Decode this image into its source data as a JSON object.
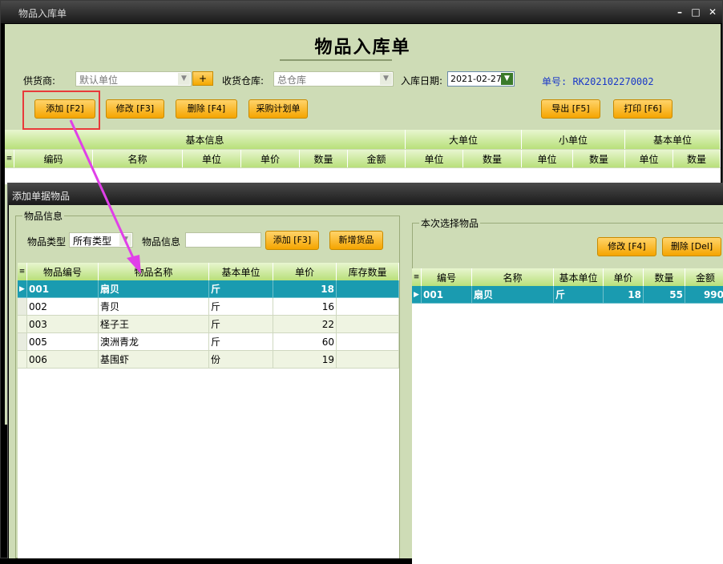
{
  "main_window": {
    "title": "物品入库单",
    "controls": {
      "minimize": "–",
      "maximize": "□",
      "close": "✕"
    }
  },
  "form": {
    "title": "物品入库单",
    "supplier_label": "供货商:",
    "supplier_value": "默认单位",
    "add_supplier_label": "+",
    "warehouse_label": "收货仓库:",
    "warehouse_value": "总仓库",
    "date_label": "入库日期:",
    "date_value": "2021-02-27",
    "order_no": "单号: RK202102270002"
  },
  "toolbar": {
    "add": "添加 [F2]",
    "edit": "修改 [F3]",
    "delete": "删除 [F4]",
    "purchase_plan": "采购计划单",
    "export": "导出 [F5]",
    "print": "打印 [F6]"
  },
  "main_grid": {
    "groups": [
      "基本信息",
      "大单位",
      "小单位",
      "基本单位"
    ],
    "columns": [
      "编码",
      "名称",
      "单位",
      "单价",
      "数量",
      "金额",
      "单位",
      "数量",
      "单位",
      "数量",
      "单位",
      "数量"
    ]
  },
  "dialog": {
    "title": "添加单据物品",
    "item_info_group": "物品信息",
    "category_label": "物品类型",
    "category_value": "所有类型",
    "item_info_label": "物品信息",
    "search_value": "",
    "add_button": "添加 [F3]",
    "new_item_button": "新增货品",
    "left_columns": [
      "物品编号",
      "物品名称",
      "基本单位",
      "单价",
      "库存数量"
    ],
    "left_rows": [
      {
        "code": "001",
        "name": "扇贝",
        "unit": "斤",
        "price": "18",
        "stock": ""
      },
      {
        "code": "002",
        "name": "青贝",
        "unit": "斤",
        "price": "16",
        "stock": ""
      },
      {
        "code": "003",
        "name": "柽子王",
        "unit": "斤",
        "price": "22",
        "stock": ""
      },
      {
        "code": "005",
        "name": "澳洲青龙",
        "unit": "斤",
        "price": "60",
        "stock": ""
      },
      {
        "code": "006",
        "name": "基围虾",
        "unit": "份",
        "price": "19",
        "stock": ""
      }
    ],
    "selected_group": "本次选择物品",
    "edit_button": "修改 [F4]",
    "delete_button": "删除 [Del]",
    "right_columns": [
      "编号",
      "名称",
      "基本单位",
      "单价",
      "数量",
      "金额"
    ],
    "right_rows": [
      {
        "code": "001",
        "name": "扇贝",
        "unit": "斤",
        "price": "18",
        "qty": "55",
        "amount": "990"
      }
    ]
  },
  "colors": {
    "panel_bg": "#cedcb6",
    "button_gradient_top": "#ffd36a",
    "button_gradient_bottom": "#f5a500",
    "selected_row": "#1a9bb0",
    "highlight_box": "#e83a3a",
    "annotation_arrow": "#e040e8",
    "order_no": "#1a38c8"
  }
}
